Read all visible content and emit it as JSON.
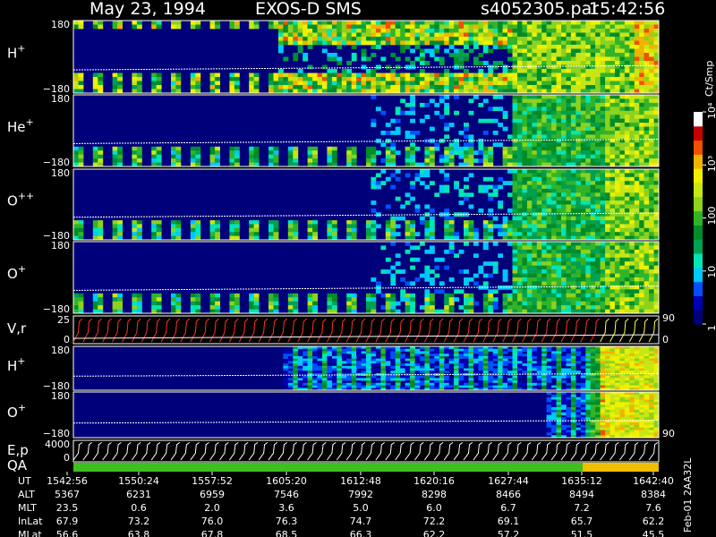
{
  "header": {
    "date": "May 23, 1994",
    "instrument": "EXOS-D SMS",
    "file": "s4052305.par",
    "time": "15:42:56"
  },
  "footer": {
    "version": "Feb-01 2AA32L"
  },
  "colorbar": {
    "unit": "Ct/Smp",
    "tick_labels": [
      "1",
      "10",
      "100",
      "10³",
      "10⁴"
    ],
    "colors": [
      "#00007a",
      "#0000b4",
      "#0050ff",
      "#00c8ff",
      "#00e6b4",
      "#00a050",
      "#008c28",
      "#32b428",
      "#8cd21e",
      "#c8e614",
      "#f0f000",
      "#f0b400",
      "#f05000",
      "#c80000",
      "#ffffff"
    ]
  },
  "chart_data": {
    "type": "heatmap",
    "panels": [
      {
        "label": "H",
        "superscript": "+",
        "ytop": "180",
        "ybot": "−180",
        "kind": "spectrogram"
      },
      {
        "label": "He",
        "superscript": "+",
        "ytop": "180",
        "ybot": "−180",
        "kind": "spectrogram"
      },
      {
        "label": "O",
        "superscript": "++",
        "ytop": "180",
        "ybot": "−180",
        "kind": "spectrogram"
      },
      {
        "label": "O",
        "superscript": "+",
        "ytop": "180",
        "ybot": "−180",
        "kind": "spectrogram"
      },
      {
        "label": "V,r",
        "superscript": "",
        "ytop": "25",
        "ybot": "0",
        "right_top": "90",
        "right_bot": "0",
        "kind": "lineplot"
      },
      {
        "label": "H",
        "superscript": "+",
        "ytop": "180",
        "ybot": "−180",
        "kind": "spectrogram"
      },
      {
        "label": "O",
        "superscript": "+",
        "ytop": "180",
        "ybot": "−180",
        "right_bot": "90",
        "kind": "spectrogram"
      },
      {
        "label": "E,p",
        "superscript": "",
        "ytop": "4000",
        "ybot": "0",
        "kind": "lineplot"
      },
      {
        "label": "QA",
        "superscript": "",
        "kind": "bar"
      }
    ],
    "ephemeris": {
      "row_labels": [
        "UT",
        "ALT",
        "MLT",
        "InLat",
        "MLat"
      ],
      "columns": [
        [
          "1542:56",
          "5367",
          "23.5",
          "67.9",
          "56.6"
        ],
        [
          "1550:24",
          "6231",
          "0.6",
          "73.2",
          "63.8"
        ],
        [
          "1557:52",
          "6959",
          "2.0",
          "76.0",
          "67.8"
        ],
        [
          "1605:20",
          "7546",
          "3.6",
          "76.3",
          "68.5"
        ],
        [
          "1612:48",
          "7992",
          "5.0",
          "74.7",
          "66.3"
        ],
        [
          "1620:16",
          "8298",
          "6.0",
          "72.2",
          "62.2"
        ],
        [
          "1627:44",
          "8466",
          "6.7",
          "69.1",
          "57.2"
        ],
        [
          "1635:12",
          "8494",
          "7.2",
          "65.7",
          "51.5"
        ],
        [
          "1642:40",
          "8384",
          "7.6",
          "62.2",
          "45.5"
        ]
      ]
    }
  }
}
